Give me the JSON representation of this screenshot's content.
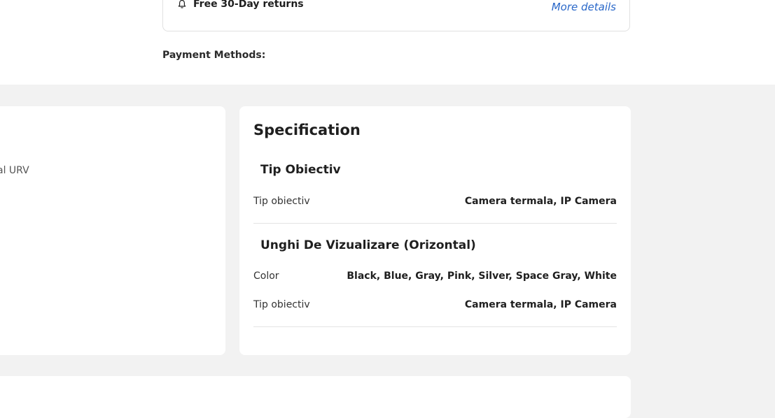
{
  "shipping": {
    "returns_label": "Free 30-Day returns",
    "more_details": "More details"
  },
  "payment": {
    "label": "Payment Methods:"
  },
  "left_card": {
    "partial_text": "al URV"
  },
  "specification": {
    "title": "Specification",
    "groups": [
      {
        "title": "Tip Obiectiv",
        "rows": [
          {
            "label": "Tip obiectiv",
            "value": "Camera termala, IP Camera"
          }
        ]
      },
      {
        "title": "Unghi De Vizualizare (Orizontal)",
        "rows": [
          {
            "label": "Color",
            "value": "Black, Blue, Gray, Pink, Silver, Space Gray, White"
          },
          {
            "label": "Tip obiectiv",
            "value": "Camera termala, IP Camera"
          }
        ]
      }
    ]
  },
  "icons": {
    "returns": "bell-icon"
  }
}
